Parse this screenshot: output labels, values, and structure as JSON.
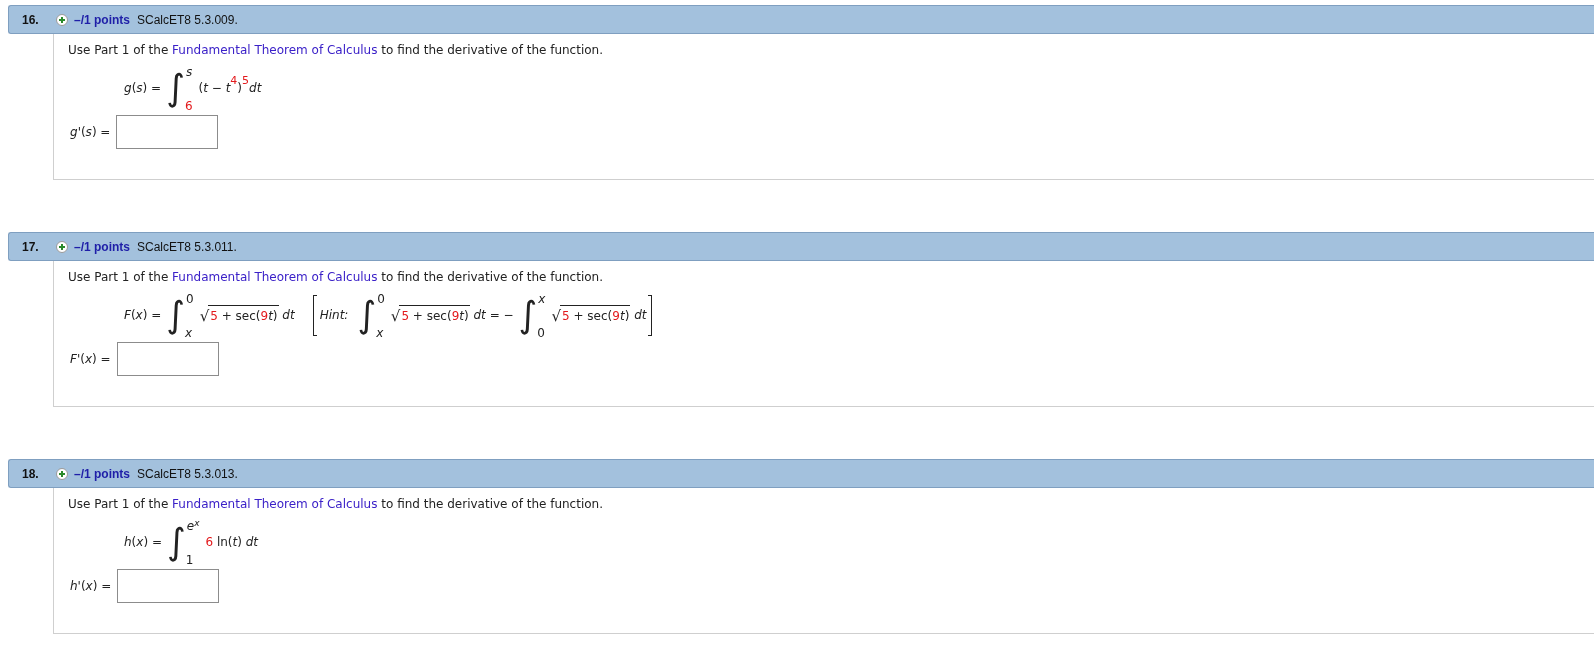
{
  "questions": [
    {
      "number": "16.",
      "points": "–/1 points",
      "code": "SCalcET8 5.3.009.",
      "prompt": {
        "before": "Use Part 1 of the ",
        "link": "Fundamental Theorem of Calculus",
        "after": " to find the derivative of the function."
      },
      "formula": [
        {
          "kind": "text",
          "text": "*g*(*s*) ="
        },
        {
          "kind": "integral",
          "sign": "∫",
          "upper": [
            {
              "kind": "text",
              "text": "*s*"
            }
          ],
          "lower": [
            {
              "kind": "given",
              "text": "6"
            }
          ]
        },
        {
          "kind": "text",
          "text": "(*t* − *t*"
        },
        {
          "kind": "power",
          "text": "4"
        },
        {
          "kind": "text",
          "text": ")"
        },
        {
          "kind": "power",
          "text": "5"
        },
        {
          "kind": "text",
          "text": "*dt*"
        }
      ],
      "answer": {
        "label": "*g*'(*s*) ="
      }
    },
    {
      "number": "17.",
      "points": "–/1 points",
      "code": "SCalcET8 5.3.011.",
      "prompt": {
        "before": "Use Part 1 of the ",
        "link": "Fundamental Theorem of Calculus",
        "after": " to find the derivative of the function."
      },
      "formula": [
        {
          "kind": "text",
          "text": "*F*(*x*) ="
        },
        {
          "kind": "integral",
          "sign": "∫",
          "upper": [
            {
              "kind": "text",
              "text": "0"
            }
          ],
          "lower": [
            {
              "kind": "text",
              "text": "*x*"
            }
          ]
        },
        {
          "kind": "sqrt",
          "sign": "√",
          "body": [
            {
              "kind": "given",
              "text": "5"
            },
            {
              "kind": "text",
              "text": " + sec("
            },
            {
              "kind": "given",
              "text": "9"
            },
            {
              "kind": "text",
              "text": "*t*)"
            }
          ]
        },
        {
          "kind": "text",
          "text": " *dt*"
        }
      ],
      "hint": {
        "label": "Hint:",
        "body": [
          {
            "kind": "integral",
            "sign": "∫",
            "upper": [
              {
                "kind": "text",
                "text": "0"
              }
            ],
            "lower": [
              {
                "kind": "text",
                "text": "*x*"
              }
            ]
          },
          {
            "kind": "sqrt",
            "sign": "√",
            "body": [
              {
                "kind": "given",
                "text": "5"
              },
              {
                "kind": "text",
                "text": " + sec("
              },
              {
                "kind": "given",
                "text": "9"
              },
              {
                "kind": "text",
                "text": "*t*)"
              }
            ]
          },
          {
            "kind": "text",
            "text": " *dt* = −"
          },
          {
            "kind": "integral",
            "sign": "∫",
            "upper": [
              {
                "kind": "text",
                "text": "*x*"
              }
            ],
            "lower": [
              {
                "kind": "text",
                "text": "0"
              }
            ]
          },
          {
            "kind": "sqrt",
            "sign": "√",
            "body": [
              {
                "kind": "given",
                "text": "5"
              },
              {
                "kind": "text",
                "text": " + sec("
              },
              {
                "kind": "given",
                "text": "9"
              },
              {
                "kind": "text",
                "text": "*t*)"
              }
            ]
          },
          {
            "kind": "text",
            "text": " *dt*"
          }
        ]
      },
      "answer": {
        "label": "*F*'(*x*) ="
      }
    },
    {
      "number": "18.",
      "points": "–/1 points",
      "code": "SCalcET8 5.3.013.",
      "prompt": {
        "before": "Use Part 1 of the ",
        "link": "Fundamental Theorem of Calculus",
        "after": " to find the derivative of the function."
      },
      "formula": [
        {
          "kind": "text",
          "text": "*h*(*x*) ="
        },
        {
          "kind": "integral",
          "sign": "∫",
          "upper": [
            {
              "kind": "text",
              "text": "*e*$^{x}$"
            }
          ],
          "lower": [
            {
              "kind": "text",
              "text": "1"
            }
          ]
        },
        {
          "kind": "given",
          "text": "6"
        },
        {
          "kind": "text",
          "text": " ln(*t*) *dt*"
        }
      ],
      "answer": {
        "label": "*h*'(*x*) ="
      }
    }
  ]
}
